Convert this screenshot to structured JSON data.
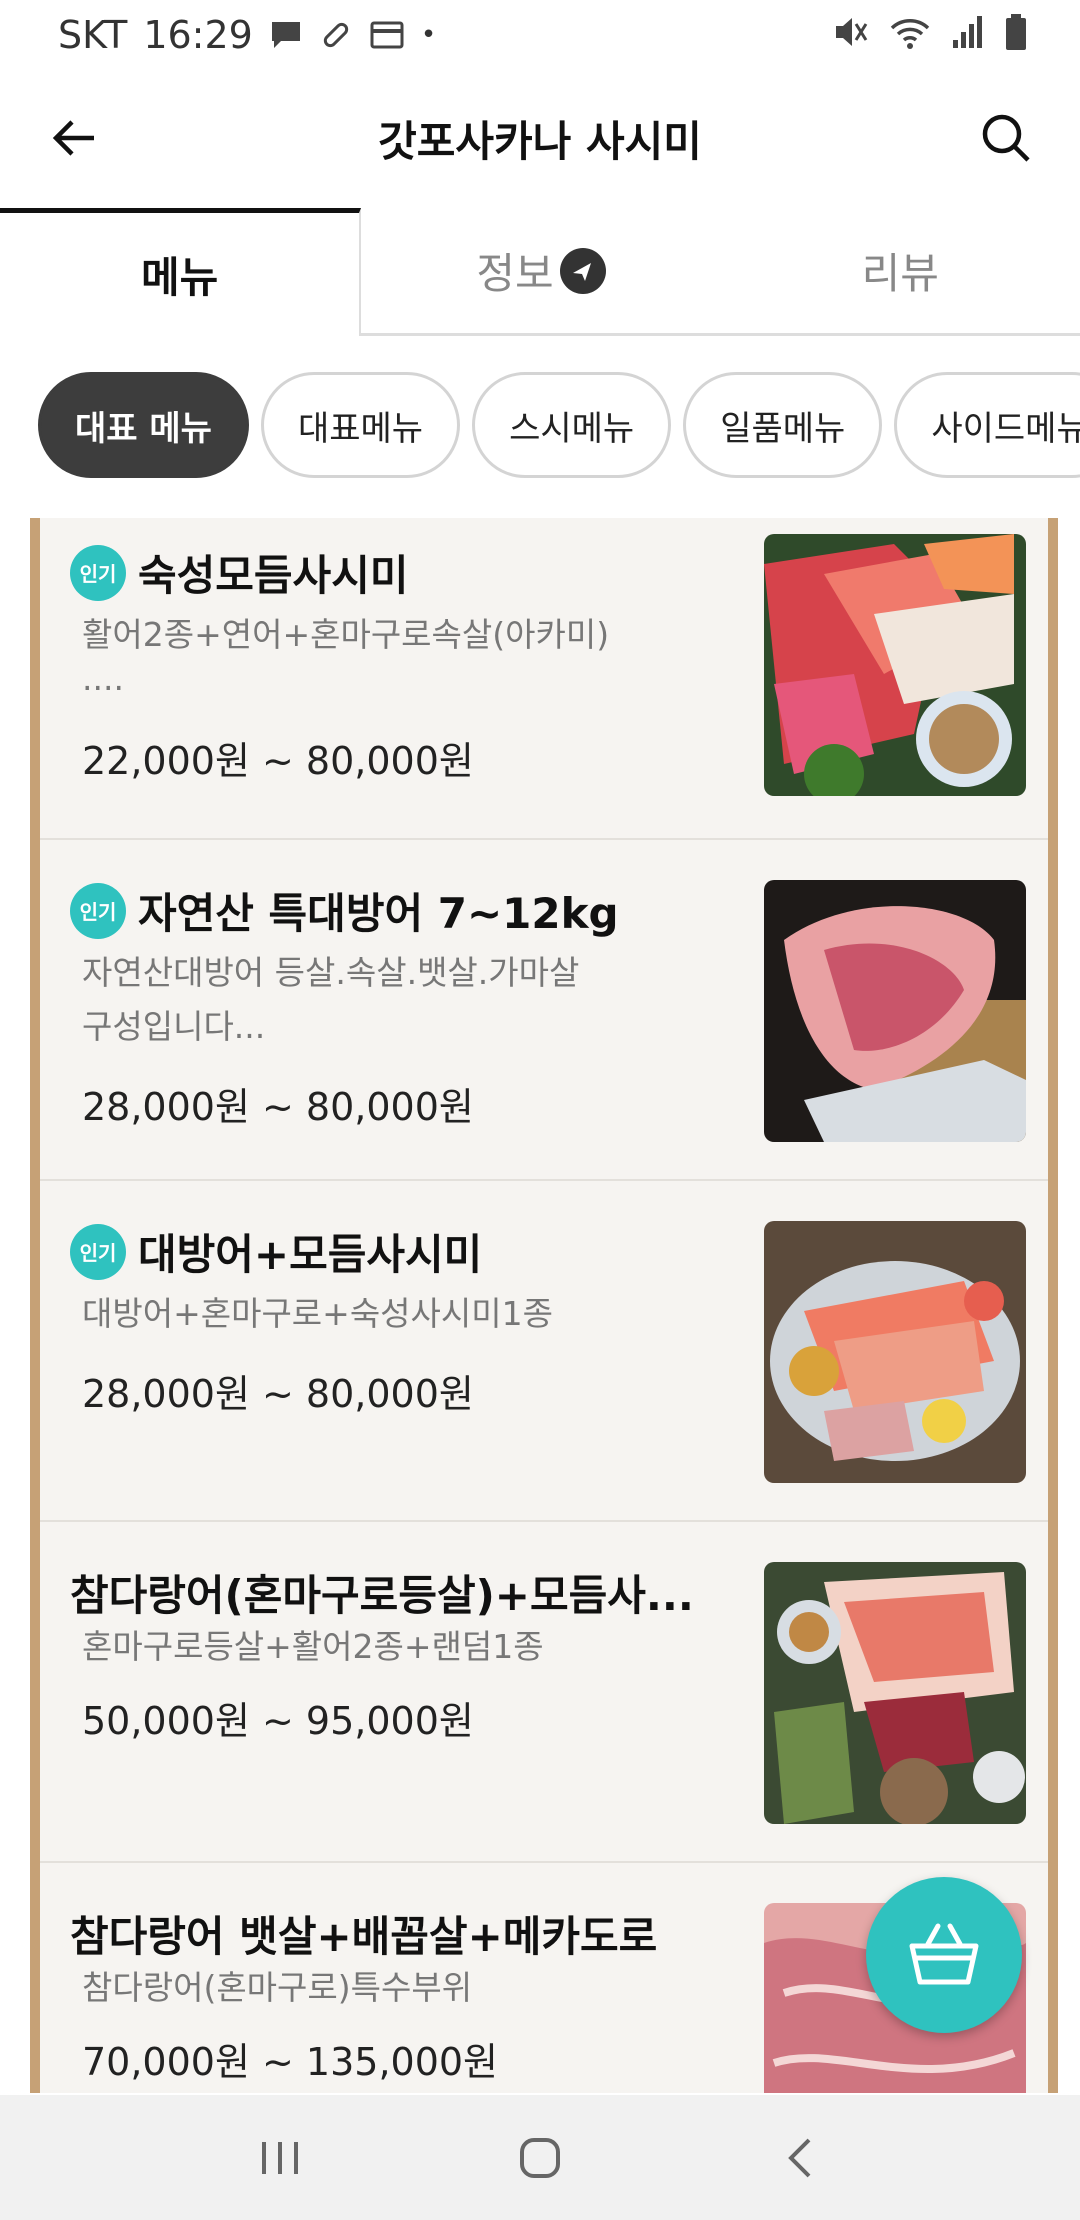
{
  "status_bar": {
    "carrier": "SKT",
    "time": "16:29",
    "dot": "•"
  },
  "app_bar": {
    "title": "갓포사카나 사시미"
  },
  "tabs": [
    {
      "label": "메뉴",
      "active": true
    },
    {
      "label": "정보",
      "active": false
    },
    {
      "label": "리뷰",
      "active": false
    }
  ],
  "chips": [
    {
      "label": "대표 메뉴",
      "active": true
    },
    {
      "label": "대표메뉴",
      "active": false
    },
    {
      "label": "스시메뉴",
      "active": false
    },
    {
      "label": "일품메뉴",
      "active": false
    },
    {
      "label": "사이드메뉴",
      "active": false
    }
  ],
  "menu_items": [
    {
      "badge": "인기",
      "name": "숙성모듬사시미",
      "desc_line1": "활어2종+연어+혼마구로속살(아카미)",
      "desc_line2": "....",
      "price": "22,000원 ~ 80,000원"
    },
    {
      "badge": "인기",
      "name": "자연산 특대방어 7~12kg",
      "desc_line1": "자연산대방어  등살.속살.뱃살.가마살",
      "desc_line2": "구성입니다...",
      "price": "28,000원 ~ 80,000원"
    },
    {
      "badge": "인기",
      "name": "대방어+모듬사시미",
      "desc_line1": "대방어+혼마구로+숙성사시미1종",
      "price": "28,000원 ~ 80,000원"
    },
    {
      "name": "참다랑어(혼마구로등살)+모듬사...",
      "desc_line1": "혼마구로등살+활어2종+랜덤1종",
      "price": "50,000원 ~ 95,000원"
    },
    {
      "name": "참다랑어 뱃살+배꼽살+메카도로",
      "desc_line1": "참다랑어(혼마구로)특수부위",
      "price": "70,000원 ~ 135,000원"
    }
  ],
  "colors": {
    "accent": "#2fc2bf",
    "frame": "#c6a176",
    "chip_active": "#3d3d3d"
  }
}
